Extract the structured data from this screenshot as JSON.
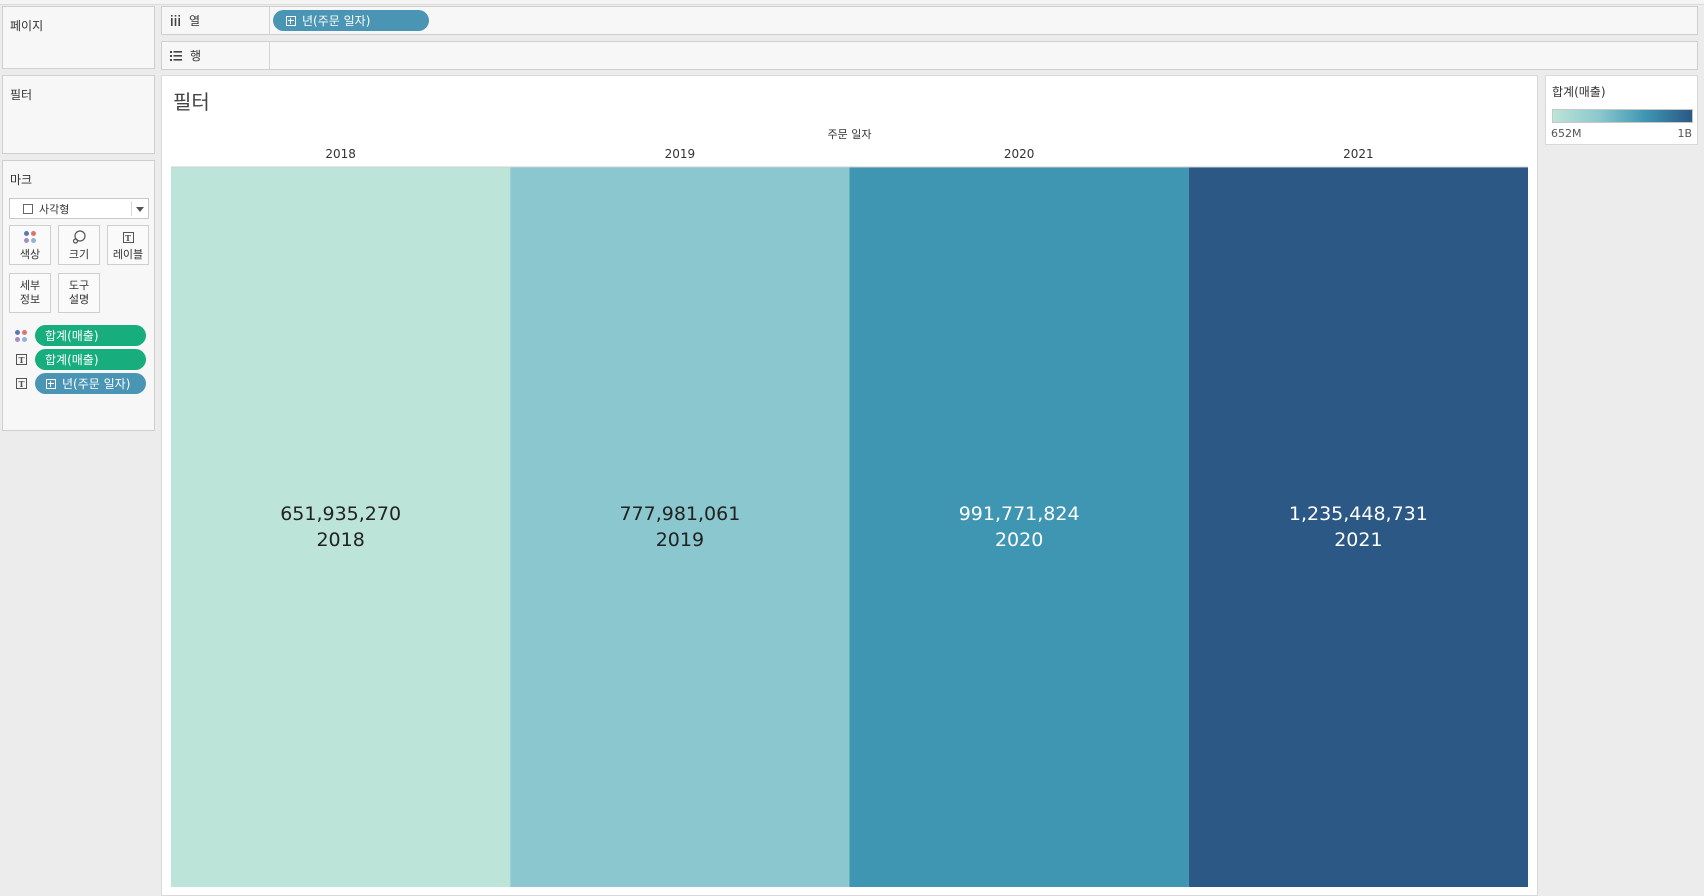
{
  "pages_panel": {
    "title": "페이지"
  },
  "filters_panel": {
    "title": "필터"
  },
  "marks_panel": {
    "title": "마크",
    "mark_type": "사각형",
    "buttons": [
      {
        "label": "색상",
        "icon": "color-dots-icon"
      },
      {
        "label": "크기",
        "icon": "size-icon"
      },
      {
        "label": "레이블",
        "icon": "label-icon"
      },
      {
        "label": "세부\n정보",
        "icon": ""
      },
      {
        "label": "도구\n설명",
        "icon": ""
      }
    ],
    "fields": [
      {
        "icon": "color-dots-icon",
        "label": "합계(매출)",
        "color": "#17ad7c",
        "has_plus": false
      },
      {
        "icon": "text-label-icon",
        "label": "합계(매출)",
        "color": "#17ad7c",
        "has_plus": false
      },
      {
        "icon": "text-label-icon",
        "label": "년(주문 일자)",
        "color": "#4a95b4",
        "has_plus": true
      }
    ]
  },
  "shelves": {
    "columns": {
      "icon": "columns-icon",
      "label": "열",
      "pill": "년(주문 일자)"
    },
    "rows": {
      "icon": "rows-icon",
      "label": "행"
    }
  },
  "view": {
    "title": "필터",
    "column_header": "주문 일자"
  },
  "legend": {
    "title": "합계(매출)",
    "min_label": "652M",
    "max_label": "1B",
    "gradient": [
      "#bde4d8",
      "#8bc7ce",
      "#3e96b2",
      "#2b5884"
    ]
  },
  "chart_data": {
    "type": "heatmap",
    "xlabel": "주문 일자",
    "categories": [
      "2018",
      "2019",
      "2020",
      "2021"
    ],
    "values": [
      651935270,
      777981061,
      991771824,
      1235448731
    ],
    "value_labels": [
      "651,935,270",
      "777,981,061",
      "991,771,824",
      "1,235,448,731"
    ],
    "colors": [
      "#bde4d8",
      "#8bc7ce",
      "#3e96b2",
      "#2b5884"
    ],
    "label_colors": [
      "#222222",
      "#222222",
      "#ffffff",
      "#ffffff"
    ],
    "color_range": [
      651935270,
      1235448731
    ]
  }
}
